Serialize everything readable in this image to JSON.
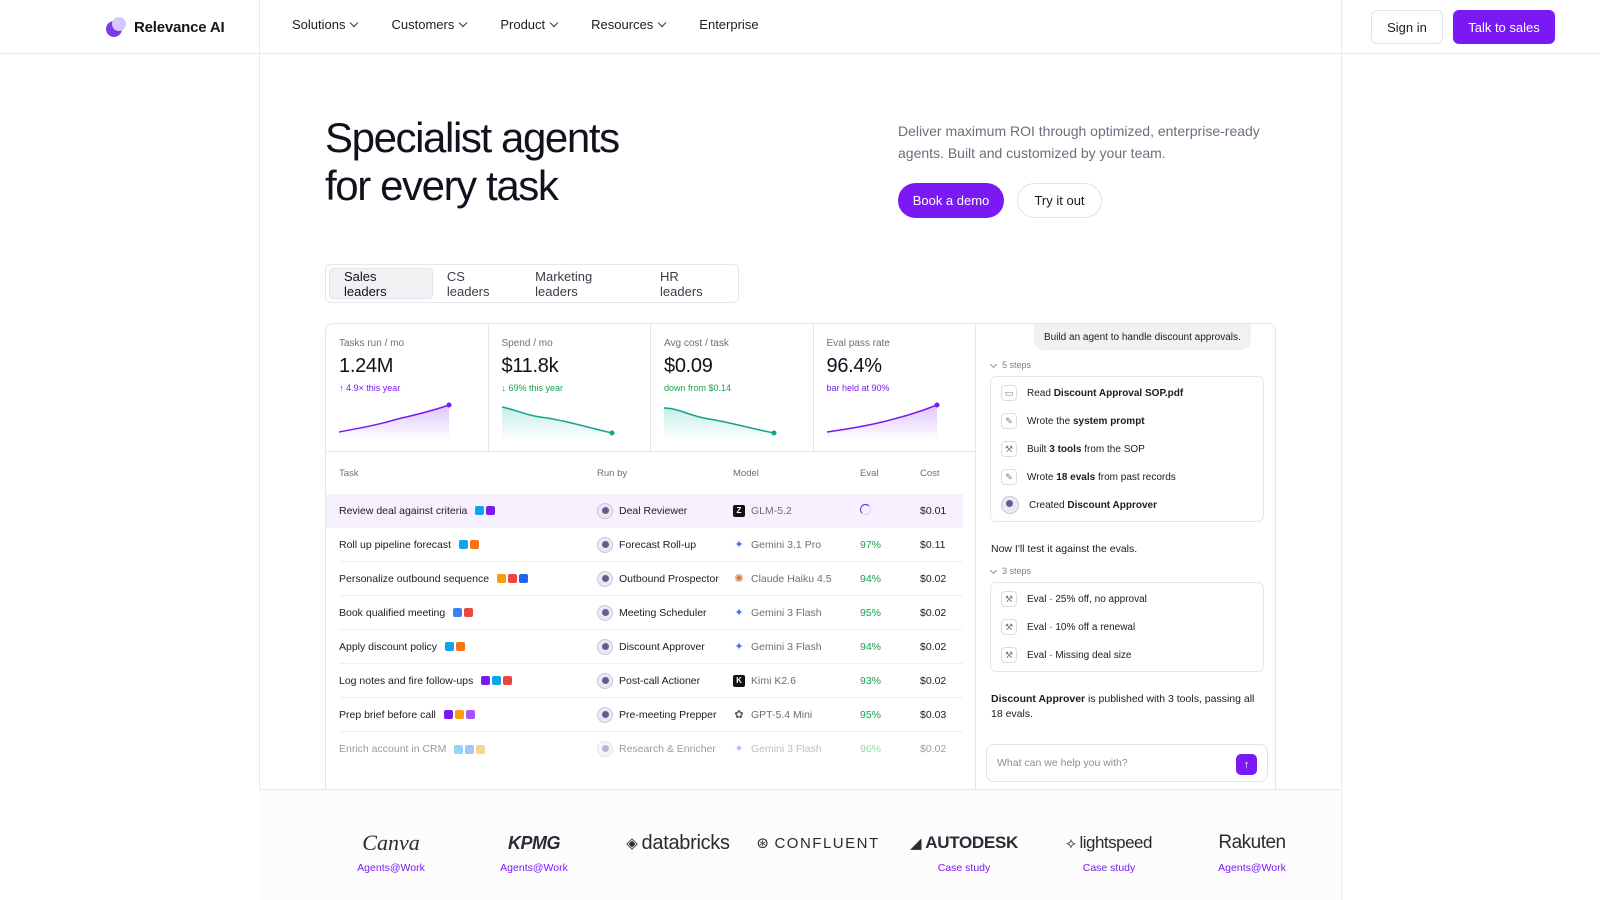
{
  "header": {
    "brand": "Relevance AI",
    "nav": [
      {
        "label": "Solutions",
        "has_menu": true
      },
      {
        "label": "Customers",
        "has_menu": true
      },
      {
        "label": "Product",
        "has_menu": true
      },
      {
        "label": "Resources",
        "has_menu": true
      },
      {
        "label": "Enterprise",
        "has_menu": false
      }
    ],
    "signin": "Sign in",
    "talk_to_sales": "Talk to sales"
  },
  "hero": {
    "title_line1": "Specialist agents",
    "title_line2": "for every task",
    "description": "Deliver maximum ROI through optimized, enterprise-ready agents. Built and customized by your team.",
    "cta_primary": "Book a demo",
    "cta_secondary": "Try it out"
  },
  "tabs": [
    {
      "label": "Sales leaders",
      "active": true
    },
    {
      "label": "CS leaders",
      "active": false
    },
    {
      "label": "Marketing leaders",
      "active": false
    },
    {
      "label": "HR leaders",
      "active": false
    }
  ],
  "kpis": [
    {
      "label": "Tasks run / mo",
      "value": "1.24M",
      "delta": "↑ 4.9× this year",
      "delta_color": "#7b19f5"
    },
    {
      "label": "Spend / mo",
      "value": "$11.8k",
      "delta": "↓ 69% this year",
      "delta_color": "#16a34a"
    },
    {
      "label": "Avg cost / task",
      "value": "$0.09",
      "delta": "down from $0.14",
      "delta_color": "#16a34a"
    },
    {
      "label": "Eval pass rate",
      "value": "96.4%",
      "delta": "bar held at 90%",
      "delta_color": "#7b19f5"
    }
  ],
  "table": {
    "headers": {
      "task": "Task",
      "run_by": "Run by",
      "model": "Model",
      "eval": "Eval",
      "cost": "Cost"
    },
    "rows": [
      {
        "task": "Review deal against criteria",
        "run_by": "Deal Reviewer",
        "model": "GLM-5.2",
        "model_icon": "z-logo-icon",
        "eval": "",
        "cost": "$0.01"
      },
      {
        "task": "Roll up pipeline forecast",
        "run_by": "Forecast Roll-up",
        "model": "Gemini 3.1 Pro",
        "model_icon": "gemini-icon",
        "eval": "97%",
        "cost": "$0.11"
      },
      {
        "task": "Personalize outbound sequence",
        "run_by": "Outbound Prospector",
        "model": "Claude Haiku 4.5",
        "model_icon": "claude-icon",
        "eval": "94%",
        "cost": "$0.02"
      },
      {
        "task": "Book qualified meeting",
        "run_by": "Meeting Scheduler",
        "model": "Gemini 3 Flash",
        "model_icon": "gemini-icon",
        "eval": "95%",
        "cost": "$0.02"
      },
      {
        "task": "Apply discount policy",
        "run_by": "Discount Approver",
        "model": "Gemini 3 Flash",
        "model_icon": "gemini-icon",
        "eval": "94%",
        "cost": "$0.02"
      },
      {
        "task": "Log notes and fire follow-ups",
        "run_by": "Post-call Actioner",
        "model": "Kimi K2.6",
        "model_icon": "kimi-icon",
        "eval": "93%",
        "cost": "$0.02"
      },
      {
        "task": "Prep brief before call",
        "run_by": "Pre-meeting Prepper",
        "model": "GPT-5.4 Mini",
        "model_icon": "openai-icon",
        "eval": "95%",
        "cost": "$0.03"
      },
      {
        "task": "Enrich account in CRM",
        "run_by": "Research & Enricher",
        "model": "Gemini 3 Flash",
        "model_icon": "gemini-icon",
        "eval": "96%",
        "cost": "$0.02"
      }
    ]
  },
  "chat": {
    "user_message": "Build an agent to handle discount approvals.",
    "steps1_label": "5 steps",
    "steps1": [
      {
        "pre": "Read ",
        "bold": "Discount Approval SOP.pdf",
        "post": ""
      },
      {
        "pre": "Wrote the ",
        "bold": "system prompt",
        "post": ""
      },
      {
        "pre": "Built ",
        "bold": "3 tools",
        "post": " from the SOP"
      },
      {
        "pre": "Wrote ",
        "bold": "18 evals",
        "post": " from past records"
      },
      {
        "pre": "Created ",
        "bold": "Discount Approver",
        "post": ""
      }
    ],
    "middle_text": "Now I'll test it against the evals.",
    "steps2_label": "3 steps",
    "steps2": [
      "Eval · 25% off, no approval",
      "Eval · 10% off a renewal",
      "Eval · Missing deal size"
    ],
    "final_bold": "Discount Approver",
    "final_text": " is published with 3 tools, passing all 18 evals.",
    "input_placeholder": "What can we help you with?"
  },
  "logos": [
    {
      "name": "Canva",
      "link": "Agents@Work"
    },
    {
      "name": "KPMG",
      "link": "Agents@Work"
    },
    {
      "name": "databricks",
      "link": ""
    },
    {
      "name": "CONFLUENT",
      "link": ""
    },
    {
      "name": "AUTODESK",
      "link": "Case study"
    },
    {
      "name": "lightspeed",
      "link": "Case study"
    },
    {
      "name": "Rakuten",
      "link": "Agents@Work"
    }
  ]
}
